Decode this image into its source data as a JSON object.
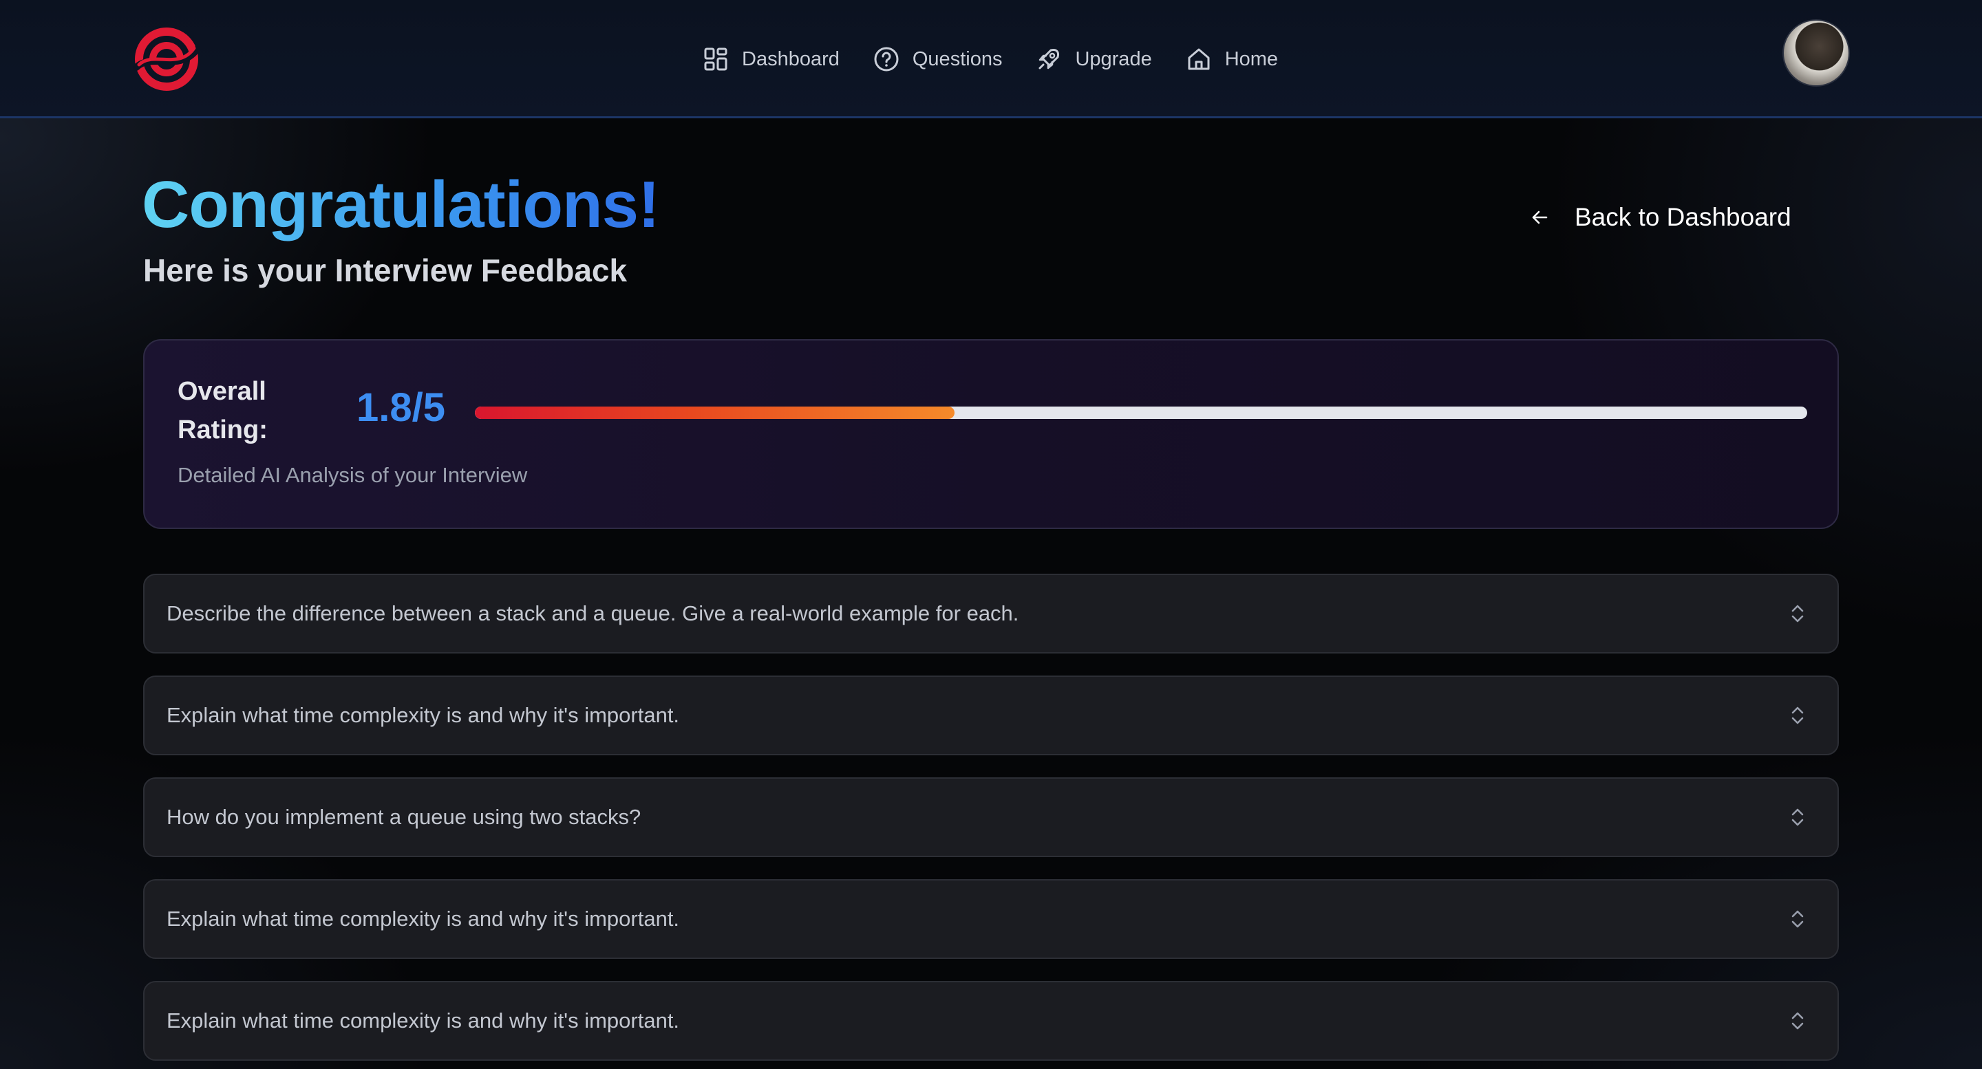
{
  "header": {
    "nav": [
      {
        "label": "Dashboard",
        "icon": "dashboard-grid-icon"
      },
      {
        "label": "Questions",
        "icon": "question-circle-icon"
      },
      {
        "label": "Upgrade",
        "icon": "rocket-icon"
      },
      {
        "label": "Home",
        "icon": "home-icon"
      }
    ]
  },
  "hero": {
    "title": "Congratulations!",
    "subtitle": "Here is your Interview Feedback",
    "back_label": "Back to Dashboard"
  },
  "rating": {
    "label": "Overall Rating:",
    "score_text": "1.8/5",
    "score": 1.8,
    "max": 5,
    "caption": "Detailed AI Analysis of your Interview"
  },
  "questions": [
    "Describe the difference between a stack and a queue. Give a real-world example for each.",
    "Explain what time complexity is and why it's important.",
    "How do you implement a queue using two stacks?",
    "Explain what time complexity is and why it's important.",
    "Explain what time complexity is and why it's important."
  ],
  "colors": {
    "accent_blue": "#3d8ef2",
    "brand_red": "#e01a34",
    "bar_start": "#d9162e",
    "bar_end": "#f58a2a"
  }
}
